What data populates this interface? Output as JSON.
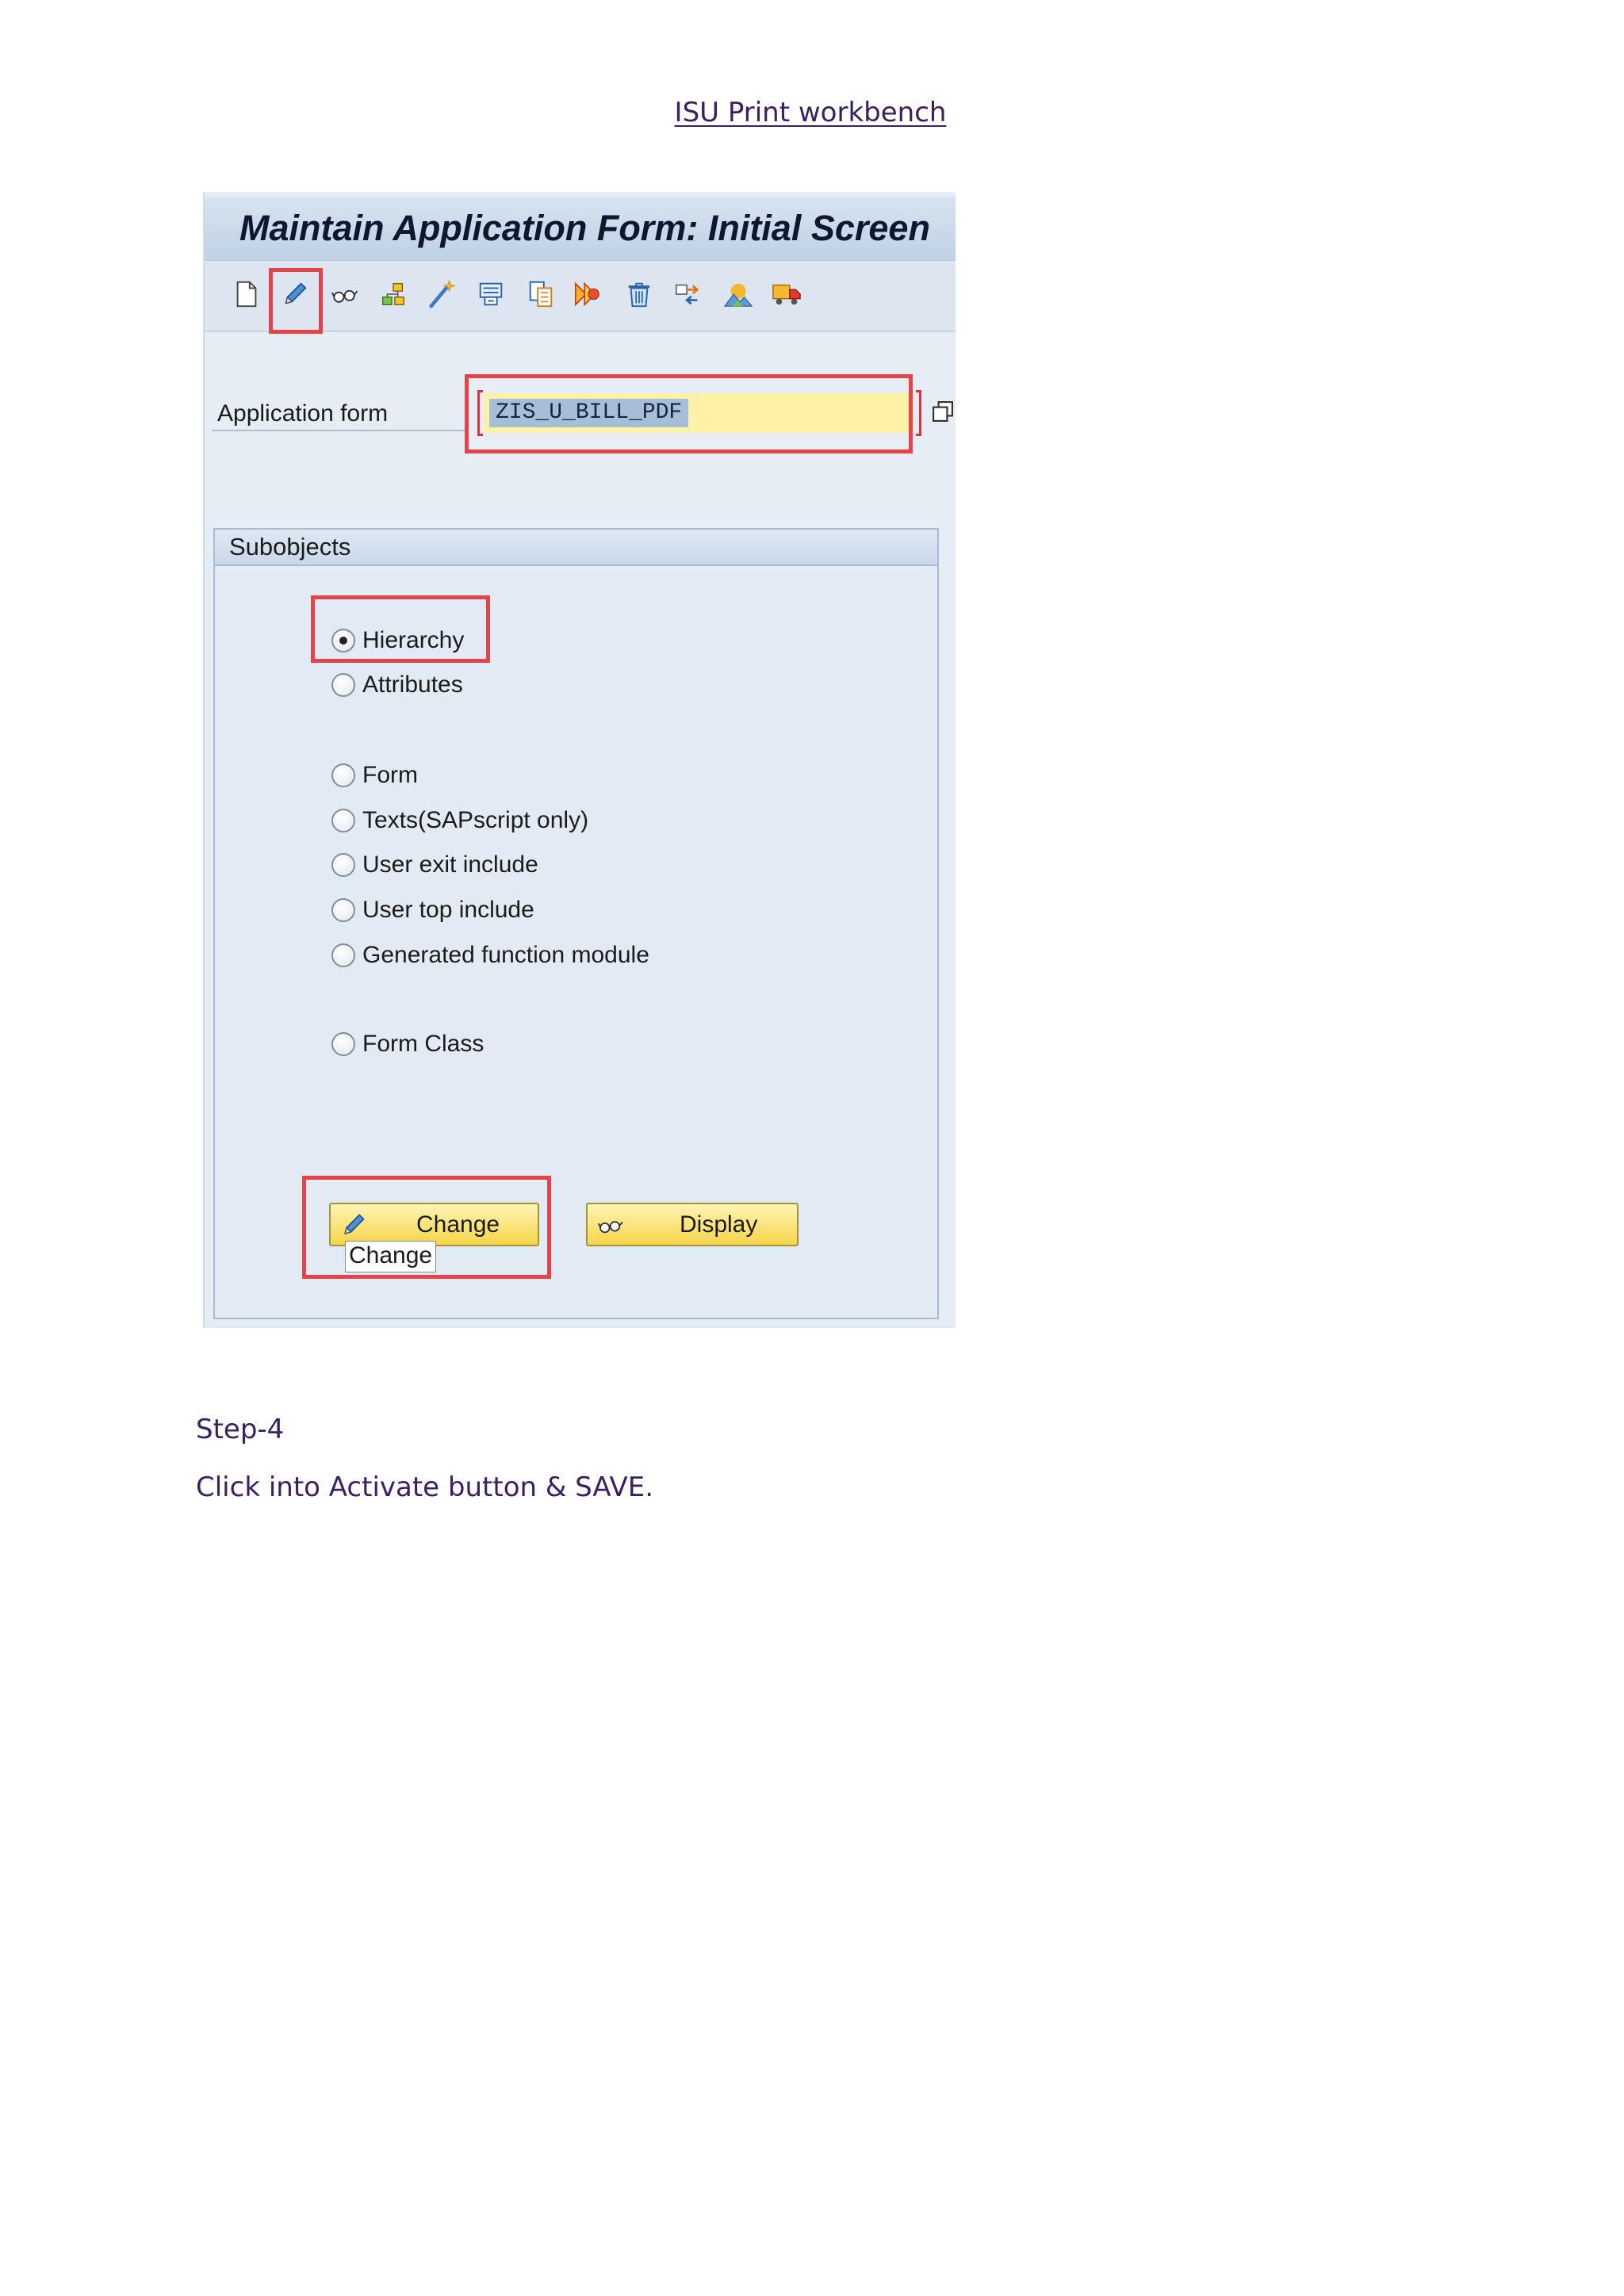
{
  "document": {
    "heading": "ISU Print workbench",
    "step_label": "Step-4",
    "instruction": "Click into Activate button & SAVE."
  },
  "sap_window": {
    "title": "Maintain Application Form: Initial Screen",
    "toolbar_icons": [
      "new-document-icon",
      "pencil-icon",
      "glasses-icon",
      "hierarchy-icon",
      "magic-wand-icon",
      "form-print-icon",
      "copy-icon",
      "activate-icon",
      "trash-icon",
      "transport-icon",
      "picture-icon",
      "truck-icon"
    ],
    "application_form": {
      "label": "Application form",
      "value": "ZIS_U_BILL_PDF",
      "value_selected": true
    },
    "subobjects": {
      "title": "Subobjects",
      "options": [
        {
          "label": "Hierarchy",
          "selected": true
        },
        {
          "label": "Attributes",
          "selected": false
        },
        {
          "label": "Form",
          "selected": false
        },
        {
          "label": "Texts(SAPscript only)",
          "selected": false
        },
        {
          "label": "User exit include",
          "selected": false
        },
        {
          "label": "User top include",
          "selected": false
        },
        {
          "label": "Generated function module",
          "selected": false
        },
        {
          "label": "Form Class",
          "selected": false
        }
      ]
    },
    "buttons": {
      "change": "Change",
      "display": "Display"
    },
    "tooltip": "Change"
  },
  "colors": {
    "highlight_red": "#e5434a",
    "input_yellow": "#fff1a6",
    "button_yellow": "#f6d549",
    "title_bar_blue": "#bfd1e5",
    "document_text": "#3a2060"
  }
}
